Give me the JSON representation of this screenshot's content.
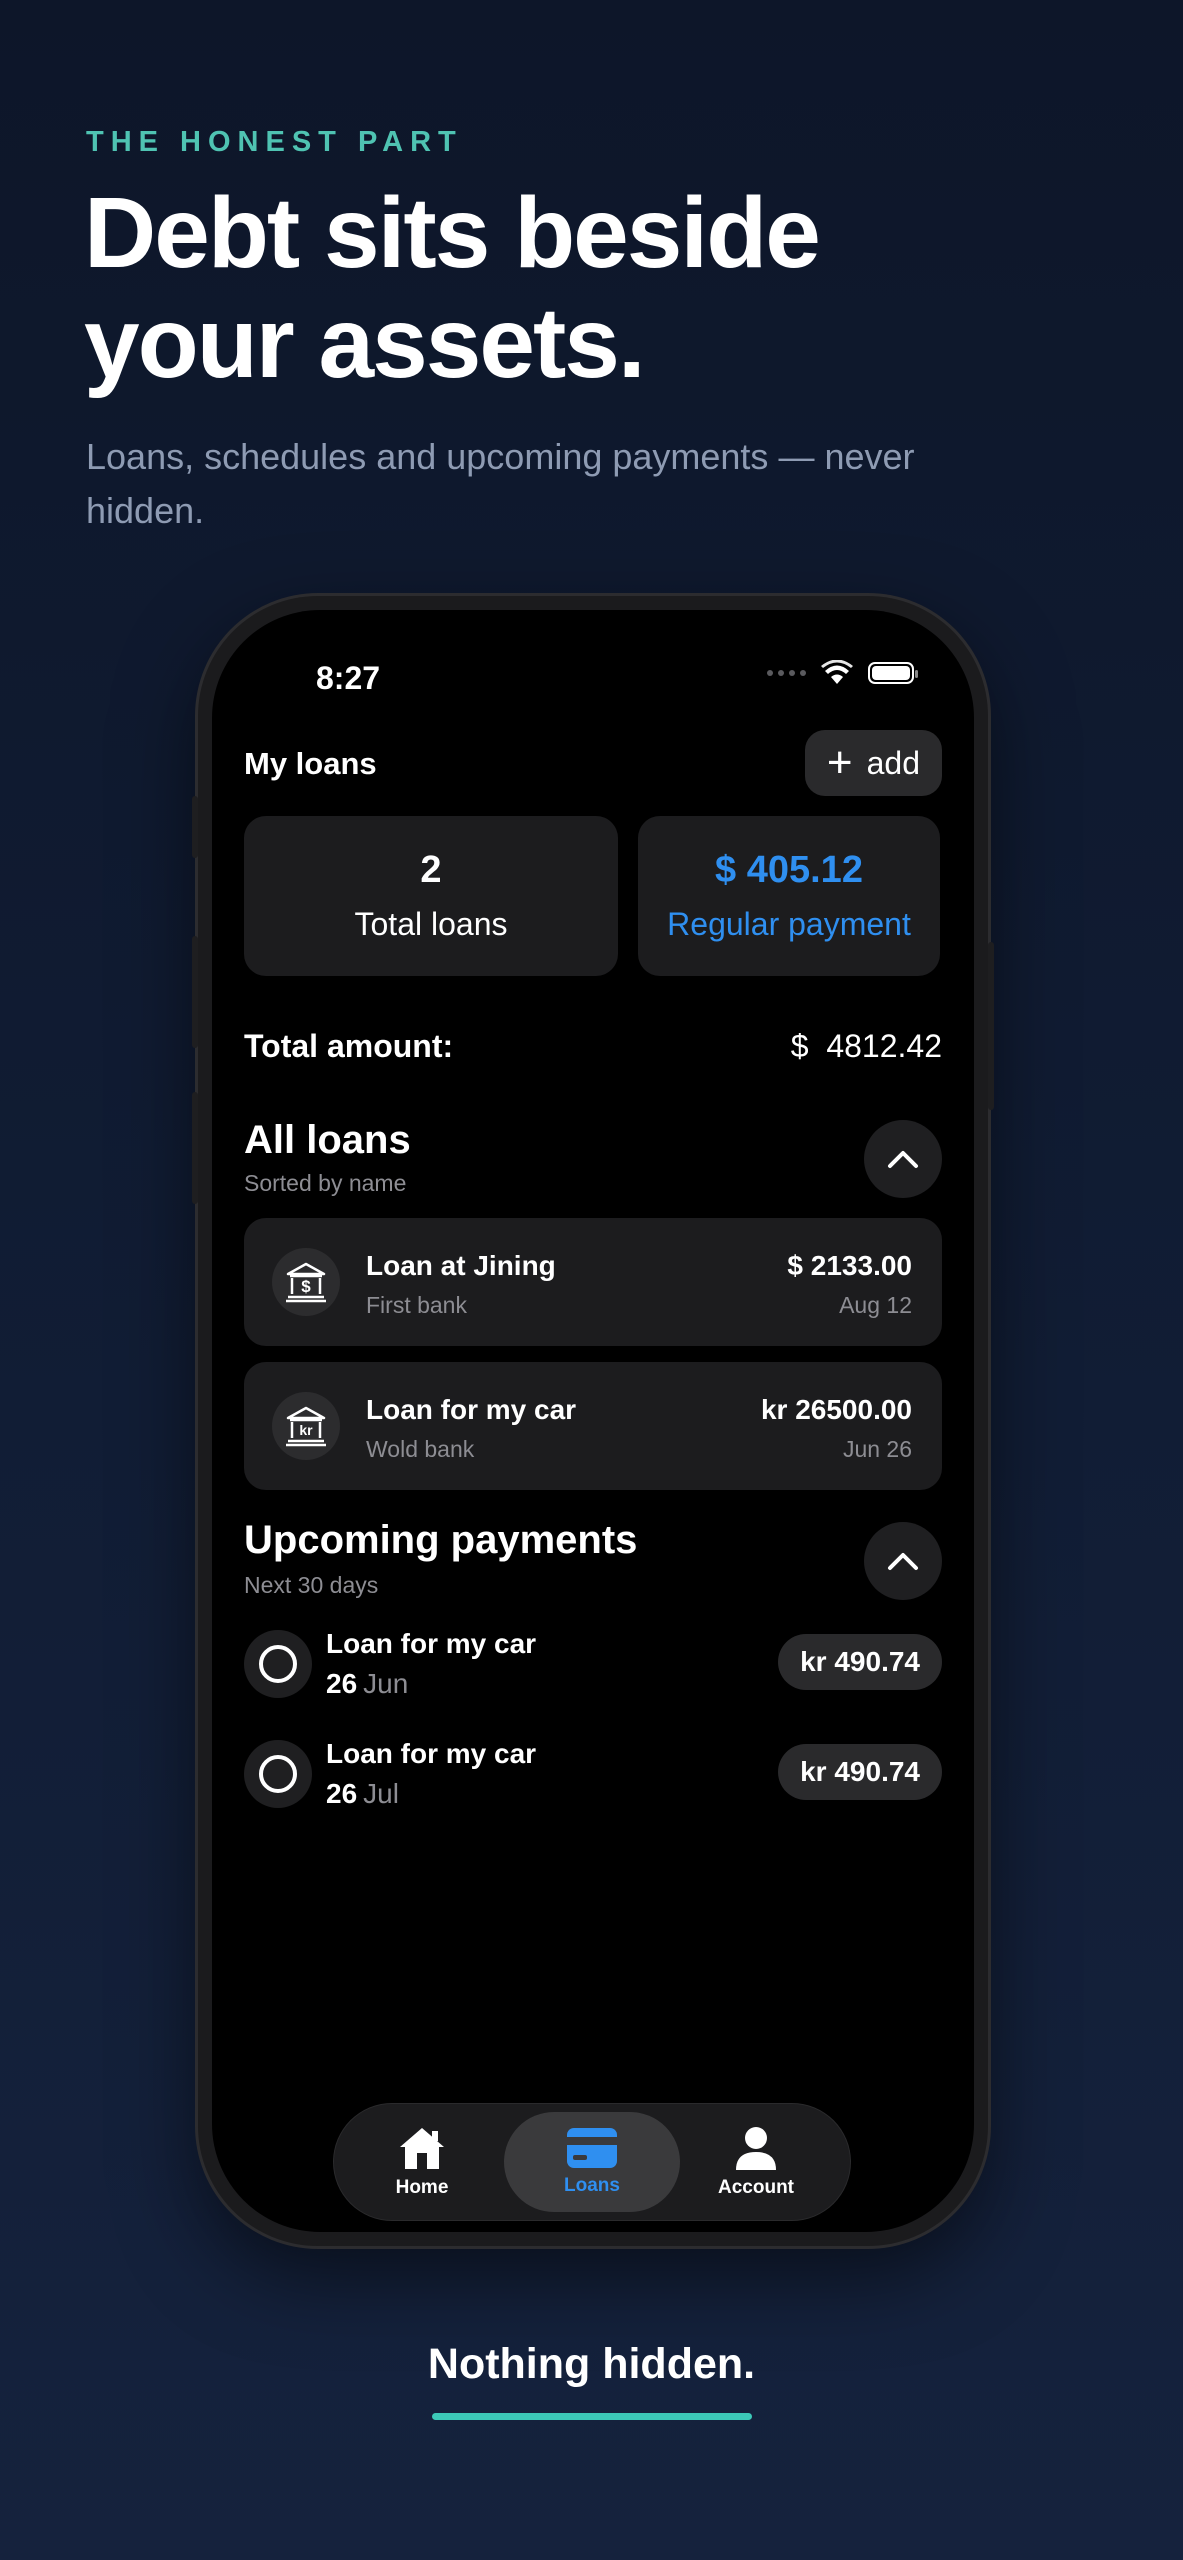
{
  "promo": {
    "eyebrow": "THE HONEST PART",
    "headline_line1": "Debt sits beside",
    "headline_line2": "your assets.",
    "subline": "Loans, schedules and upcoming payments — never hidden.",
    "footer": "Nothing hidden.",
    "accent_color": "#3cc9b8"
  },
  "status_bar": {
    "time": "8:27"
  },
  "app": {
    "title": "My loans",
    "add_label": "add",
    "stats": {
      "total_loans_value": "2",
      "total_loans_label": "Total loans",
      "regular_payment_value": "$ 405.12",
      "regular_payment_label": "Regular payment"
    },
    "total_amount": {
      "label": "Total amount:",
      "value": "$  4812.42"
    },
    "all_loans": {
      "title": "All loans",
      "subtitle": "Sorted by name",
      "items": [
        {
          "name": "Loan at Jining",
          "bank": "First bank",
          "amount": "$ 2133.00",
          "date": "Aug 12",
          "icon": "bank-dollar-icon"
        },
        {
          "name": "Loan for my car",
          "bank": "Wold bank",
          "amount": "kr 26500.00",
          "date": "Jun 26",
          "icon": "bank-krone-icon"
        }
      ]
    },
    "upcoming": {
      "title": "Upcoming payments",
      "subtitle": "Next 30 days",
      "items": [
        {
          "name": "Loan for my car",
          "day": "26",
          "month": "Jun",
          "amount": "kr 490.74"
        },
        {
          "name": "Loan for my car",
          "day": "26",
          "month": "Jul",
          "amount": "kr 490.74"
        }
      ]
    },
    "tabs": [
      {
        "label": "Home",
        "icon": "home-icon"
      },
      {
        "label": "Loans",
        "icon": "card-icon",
        "selected": true
      },
      {
        "label": "Account",
        "icon": "person-icon"
      }
    ],
    "accent_color": "#2f8ff0"
  }
}
